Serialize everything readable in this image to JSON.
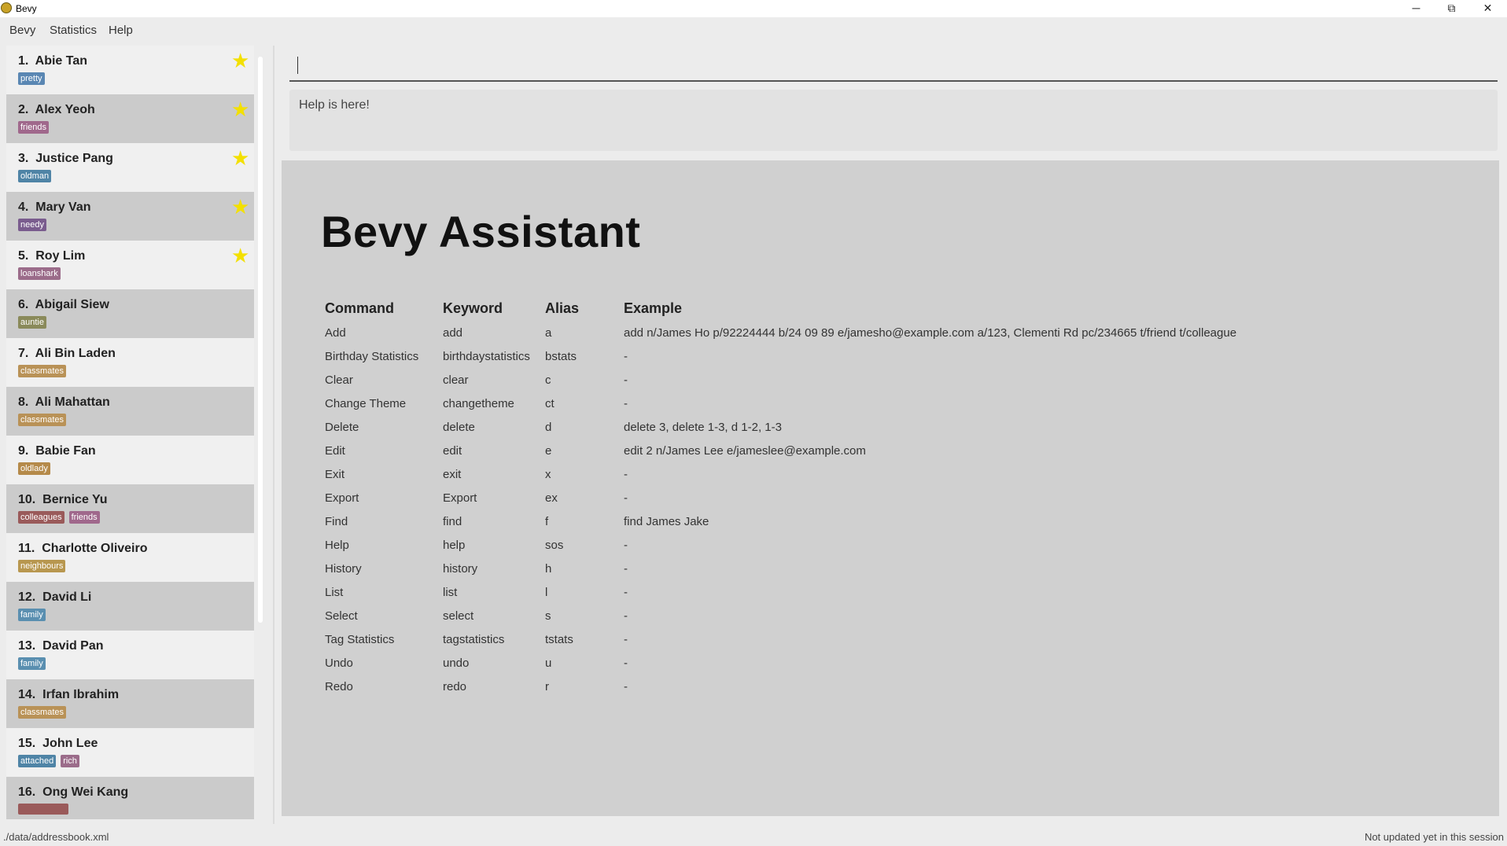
{
  "window": {
    "title": "Bevy",
    "minimize_glyph": "─",
    "restore_glyph": "⧉",
    "close_glyph": "✕"
  },
  "menu": [
    "Bevy",
    "Statistics",
    "Help"
  ],
  "people": [
    {
      "index": "1.",
      "name": "Abie Tan",
      "tags": [
        {
          "label": "pretty",
          "color": "#5a87b3"
        }
      ],
      "favorite": true
    },
    {
      "index": "2.",
      "name": "Alex Yeoh",
      "tags": [
        {
          "label": "friends",
          "color": "#a0688c"
        }
      ],
      "favorite": true
    },
    {
      "index": "3.",
      "name": "Justice Pang",
      "tags": [
        {
          "label": "oldman",
          "color": "#4f84a6"
        }
      ],
      "favorite": true
    },
    {
      "index": "4.",
      "name": "Mary Van",
      "tags": [
        {
          "label": "needy",
          "color": "#7a5c8e"
        }
      ],
      "favorite": true
    },
    {
      "index": "5.",
      "name": "Roy Lim",
      "tags": [
        {
          "label": "loanshark",
          "color": "#9b6c8a"
        }
      ],
      "favorite": true
    },
    {
      "index": "6.",
      "name": "Abigail Siew",
      "tags": [
        {
          "label": "auntie",
          "color": "#8a8a5a"
        }
      ],
      "favorite": false
    },
    {
      "index": "7.",
      "name": "Ali Bin Laden",
      "tags": [
        {
          "label": "classmates",
          "color": "#b99257"
        }
      ],
      "favorite": false
    },
    {
      "index": "8.",
      "name": "Ali Mahattan",
      "tags": [
        {
          "label": "classmates",
          "color": "#b99257"
        }
      ],
      "favorite": false
    },
    {
      "index": "9.",
      "name": "Babie Fan",
      "tags": [
        {
          "label": "oldlady",
          "color": "#b58a4a"
        }
      ],
      "favorite": false
    },
    {
      "index": "10.",
      "name": "Bernice Yu",
      "tags": [
        {
          "label": "colleagues",
          "color": "#9a5a5a"
        },
        {
          "label": "friends",
          "color": "#a0688c"
        }
      ],
      "favorite": false
    },
    {
      "index": "11.",
      "name": "Charlotte Oliveiro",
      "tags": [
        {
          "label": "neighbours",
          "color": "#b8974f"
        }
      ],
      "favorite": false
    },
    {
      "index": "12.",
      "name": "David Li",
      "tags": [
        {
          "label": "family",
          "color": "#5a8fb0"
        }
      ],
      "favorite": false
    },
    {
      "index": "13.",
      "name": "David Pan",
      "tags": [
        {
          "label": "family",
          "color": "#5a8fb0"
        }
      ],
      "favorite": false
    },
    {
      "index": "14.",
      "name": "Irfan Ibrahim",
      "tags": [
        {
          "label": "classmates",
          "color": "#b99257"
        }
      ],
      "favorite": false
    },
    {
      "index": "15.",
      "name": "John Lee",
      "tags": [
        {
          "label": "attached",
          "color": "#4f84a6"
        },
        {
          "label": "rich",
          "color": "#9b6c8a"
        }
      ],
      "favorite": false
    },
    {
      "index": "16.",
      "name": "Ong Wei Kang",
      "tags": [
        {
          "label": "",
          "color": "#9a5a5a"
        }
      ],
      "favorite": false
    }
  ],
  "command_box": {
    "value": ""
  },
  "result_display": {
    "text": "Help is here!"
  },
  "help": {
    "title": "Bevy Assistant",
    "headers": [
      "Command",
      "Keyword",
      "Alias",
      "Example"
    ],
    "rows": [
      [
        "Add",
        "add",
        "a",
        "add n/James Ho p/92224444 b/24 09 89 e/jamesho@example.com a/123, Clementi Rd pc/234665 t/friend t/colleague"
      ],
      [
        "Birthday Statistics",
        "birthdaystatistics",
        "bstats",
        "-"
      ],
      [
        "Clear",
        "clear",
        "c",
        "-"
      ],
      [
        "Change Theme",
        "changetheme",
        "ct",
        "-"
      ],
      [
        "Delete",
        "delete",
        "d",
        "delete 3, delete 1-3, d 1-2, 1-3"
      ],
      [
        "Edit",
        "edit",
        "e",
        "edit 2 n/James Lee e/jameslee@example.com"
      ],
      [
        "Exit",
        "exit",
        "x",
        "-"
      ],
      [
        "Export",
        "Export",
        "ex",
        "-"
      ],
      [
        "Find",
        "find",
        "f",
        "find James Jake"
      ],
      [
        "Help",
        "help",
        "sos",
        "-"
      ],
      [
        "History",
        "history",
        "h",
        "-"
      ],
      [
        "List",
        "list",
        "l",
        "-"
      ],
      [
        "Select",
        "select",
        "s",
        "-"
      ],
      [
        "Tag Statistics",
        "tagstatistics",
        "tstats",
        "-"
      ],
      [
        "Undo",
        "undo",
        "u",
        "-"
      ],
      [
        "Redo",
        "redo",
        "r",
        "-"
      ]
    ]
  },
  "status_bar": {
    "file_path": "./data/addressbook.xml",
    "sync_status": "Not updated yet in this session"
  }
}
